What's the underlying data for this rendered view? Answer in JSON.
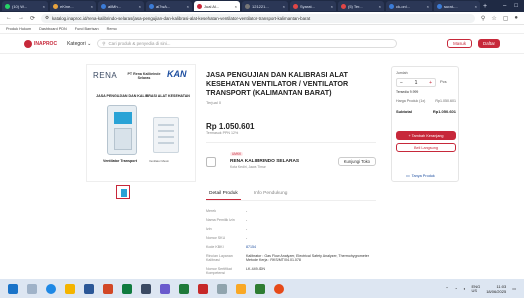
{
  "browser": {
    "tabs": [
      {
        "label": "(10) W...",
        "active": false
      },
      {
        "label": "eKine...",
        "active": false
      },
      {
        "label": "allMh...",
        "active": false
      },
      {
        "label": "al7wA...",
        "active": false
      },
      {
        "label": "Jual Al...",
        "active": true
      },
      {
        "label": "121221...",
        "active": false
      },
      {
        "label": "Syarat...",
        "active": false
      },
      {
        "label": "(5) Ter...",
        "active": false
      },
      {
        "label": "ck-onl...",
        "active": false
      },
      {
        "label": "surat-...",
        "active": false
      }
    ],
    "url": "katalog.inaproc.id/rena-kalibrindo-selaras/jasa-pengujian-dan-kalibrasi-alat-kesehatan-ventilator-ventilator-transport-kalimantan-barat",
    "new_tab": "+"
  },
  "bookmarks": [
    "Produk Hukum",
    "Dashboard PDN",
    "Fund Barrisan",
    "Remo"
  ],
  "header": {
    "logo_text": "INAPROC",
    "kategori": "Kategori",
    "search_placeholder": "Cari produk & penyedia di sini...",
    "masuk": "Masuk",
    "daftar": "Daftar"
  },
  "product_image": {
    "brand": "RENA",
    "brand_sub": "PT Rena Kalibrinde Selaras",
    "kan": "KAN",
    "headline": "JASA PENGUJIAN DAN KALIBRASI ALAT KESEHATAN",
    "device_label": "Ventilator Transport",
    "device2_label": "Ventilator Mesin"
  },
  "product": {
    "title": "JASA PENGUJIAN DAN KALIBRASI ALAT KESEHATAN VENTILATOR / VENTILATOR TRANSPORT (KALIMANTAN BARAT)",
    "sold": "Terjual 0",
    "price": "Rp 1.050.601",
    "price_note": "Termasuk PPN 12%"
  },
  "seller": {
    "badge": "UMKK",
    "name": "RENA KALIBRINDO SELARAS",
    "location": "Kota Kediri, Jawa Timur",
    "visit": "Kunjungi Toko"
  },
  "tabs": {
    "detail": "Detail Produk",
    "info": "Info Pendukung"
  },
  "specs": [
    {
      "k": "Merek",
      "v": "-"
    },
    {
      "k": "Nama Pemilik Izin",
      "v": "-"
    },
    {
      "k": "Izin",
      "v": "-"
    },
    {
      "k": "Nomor SKU",
      "v": "-"
    },
    {
      "k": "Kode KBKI",
      "v": "87154"
    },
    {
      "k": "Rincian Layanan Kalibrasi",
      "v": "Kalibrator : Gas Flow Analyzer, Electrical Safety Analyzer, Thermohygrometer Metode Kerja : RKS/MT/04.01.078"
    },
    {
      "k": "Nomor Sertifikat Kompetensi",
      "v": "LK-449-IDN"
    }
  ],
  "buy": {
    "jumlah": "Jumlah",
    "qty": "1",
    "unit": "Pcs",
    "stok": "Tersedia 9.999",
    "harga_label": "Harga Produk (1x)",
    "harga_value": "Rp1.050.601",
    "subtotal_label": "Subtotal",
    "subtotal_value": "Rp1.050.601",
    "add_cart": "+ Tambah Keranjang",
    "buy_now": "Beli Langsung",
    "ask": "Tanya Produk"
  },
  "system": {
    "lang": "ENG\nUS",
    "time": "11:03",
    "date": "18/06/2025"
  },
  "colors": {
    "brand": "#c7283a",
    "link": "#1e4fa0",
    "chrome": "#1f2a44"
  }
}
